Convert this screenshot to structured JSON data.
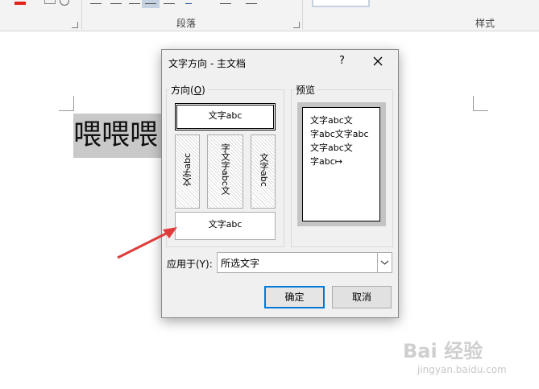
{
  "ribbon": {
    "paragraph_group": "段落",
    "styles_group": "样式"
  },
  "document": {
    "selected_text": "喂喂喂"
  },
  "dialog": {
    "title": "文字方向 - 主文档",
    "help": "?",
    "direction_label": "方向(O)",
    "direction_accel": "O",
    "preview_label": "预览",
    "options": {
      "horizontal": "文字abc",
      "vertical_rotate_left": "文字abc",
      "vertical_stacked": "字文字abc文",
      "vertical_rotate_right": "文字abc",
      "horizontal_rotated": "文字abc"
    },
    "preview_lines": [
      "文字abc文",
      "字abc文字abc",
      "文字abc文",
      "字abc↦"
    ],
    "apply_label": "应用于(Y):",
    "apply_value": "所选文字",
    "ok": "确定",
    "cancel": "取消"
  },
  "watermark": {
    "brand": "Bai 经验",
    "url": "jingyan.baidu.com"
  },
  "colors": {
    "selection": "#c9c9c9",
    "ok_border": "#0078d7",
    "arrow": "#e03c3c"
  }
}
